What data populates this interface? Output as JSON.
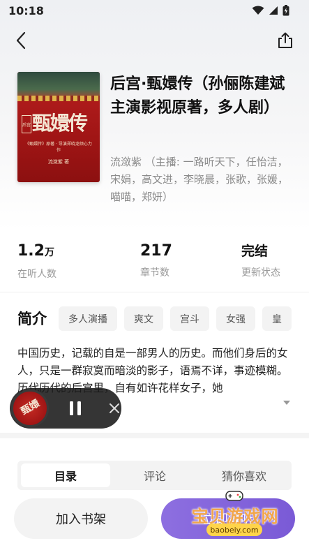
{
  "status_bar": {
    "time": "10:18"
  },
  "book": {
    "title": "后宫·甄嬛传（孙俪陈建斌主演影视原著，多人剧）",
    "meta": "流潋紫 （主播: 一路听天下，任怡洁，宋娟，高文进，李晓晨，张歌，张媛，喵喵，郑妍）",
    "cover": {
      "title": "甄嬛传",
      "seal": "后宫",
      "subtitle": "《甄嬛传》原著 · 导演郑晓龙倾心力作",
      "author": "流潋紫 著"
    }
  },
  "stats": [
    {
      "value": "1.2",
      "unit": "万",
      "label": "在听人数"
    },
    {
      "value": "217",
      "unit": "",
      "label": "章节数"
    },
    {
      "value": "完结",
      "unit": "",
      "label": "更新状态"
    }
  ],
  "intro": {
    "heading": "简介",
    "tags": [
      "多人演播",
      "爽文",
      "宫斗",
      "女强",
      "皇"
    ],
    "text": "中国历史，记载的自是一部男人的历史。而他们身后的女人，只是一群寂寞而暗淡的影子，语焉不详，事迹模糊。历代历代的后宫里，自有如许花样女子，她"
  },
  "player": {
    "cover_text": "甄嬛"
  },
  "tabs": [
    {
      "label": "目录",
      "active": true
    },
    {
      "label": "评论",
      "active": false
    },
    {
      "label": "猜你喜欢",
      "active": false
    }
  ],
  "bottom": {
    "bookshelf_label": "加入书架",
    "listen_label": "立即收听"
  },
  "watermark": {
    "text": "宝贝游戏网",
    "url": "baobeiy.com"
  },
  "colors": {
    "accent": "#7a5ad6",
    "cover_red": "#a01515"
  }
}
